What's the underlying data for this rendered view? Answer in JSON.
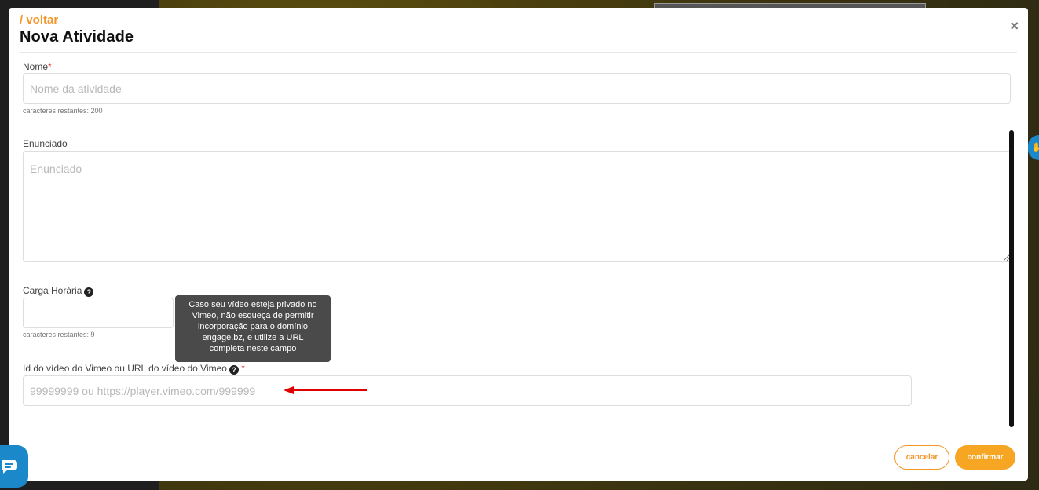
{
  "modal": {
    "back_label": "/ voltar",
    "title": "Nova Atividade",
    "close_glyph": "×"
  },
  "form": {
    "nome": {
      "label": "Nome",
      "required_mark": "*",
      "placeholder": "Nome da atividade",
      "value": "",
      "hint": "caracteres restantes: 200"
    },
    "enunciado": {
      "label": "Enunciado",
      "placeholder": "Enunciado",
      "value": ""
    },
    "carga_horaria": {
      "label": "Carga Horária",
      "help_glyph": "?",
      "value": "",
      "hint": "caracteres restantes: 9"
    },
    "video": {
      "label": "Id do vídeo do Vimeo ou URL do vídeo do Vimeo",
      "help_glyph": "?",
      "required_mark": "*",
      "placeholder": "99999999 ou https://player.vimeo.com/999999",
      "value": ""
    }
  },
  "tooltip": {
    "lines": [
      "Caso seu vídeo esteja privado no",
      "Vimeo, não esqueça de permitir",
      "incorporação para o domínio",
      "engage.bz, e utilize a URL",
      "completa neste campo"
    ]
  },
  "footer": {
    "cancel_label": "cancelar",
    "confirm_label": "confirmar"
  },
  "icons": {
    "chat": "chat-bubble-icon",
    "close": "close-icon",
    "help": "question-circle-icon",
    "accessibility": "hand-icon"
  },
  "colors": {
    "accent": "#f3962a",
    "confirm": "#f6a623",
    "required": "#e53935",
    "chat_widget": "#1a88c9",
    "annotation_arrow": "#e00000"
  }
}
